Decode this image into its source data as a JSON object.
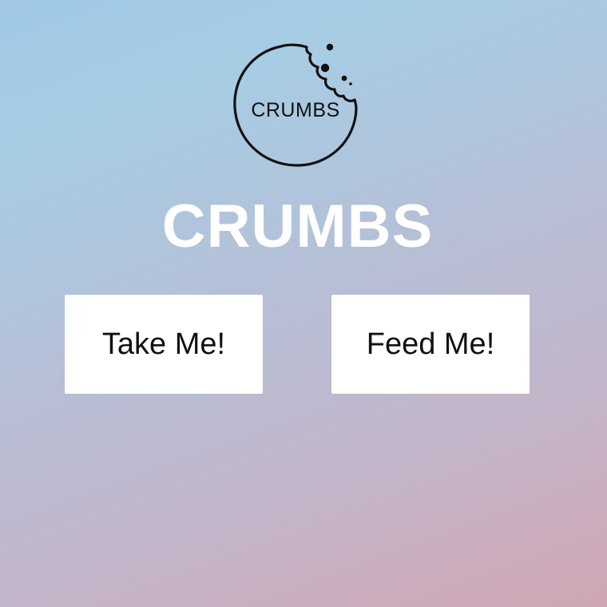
{
  "logo": {
    "icon": "cookie-bite-logo",
    "text": "CRUMBS"
  },
  "heading": {
    "title": "CRUMBS"
  },
  "actions": {
    "take_label": "Take Me!",
    "feed_label": "Feed Me!"
  },
  "colors": {
    "background_start": "#9fc8e6",
    "background_end": "#cfa6b4",
    "button_bg": "#ffffff",
    "title_color": "#ffffff",
    "logo_stroke": "#111111"
  }
}
